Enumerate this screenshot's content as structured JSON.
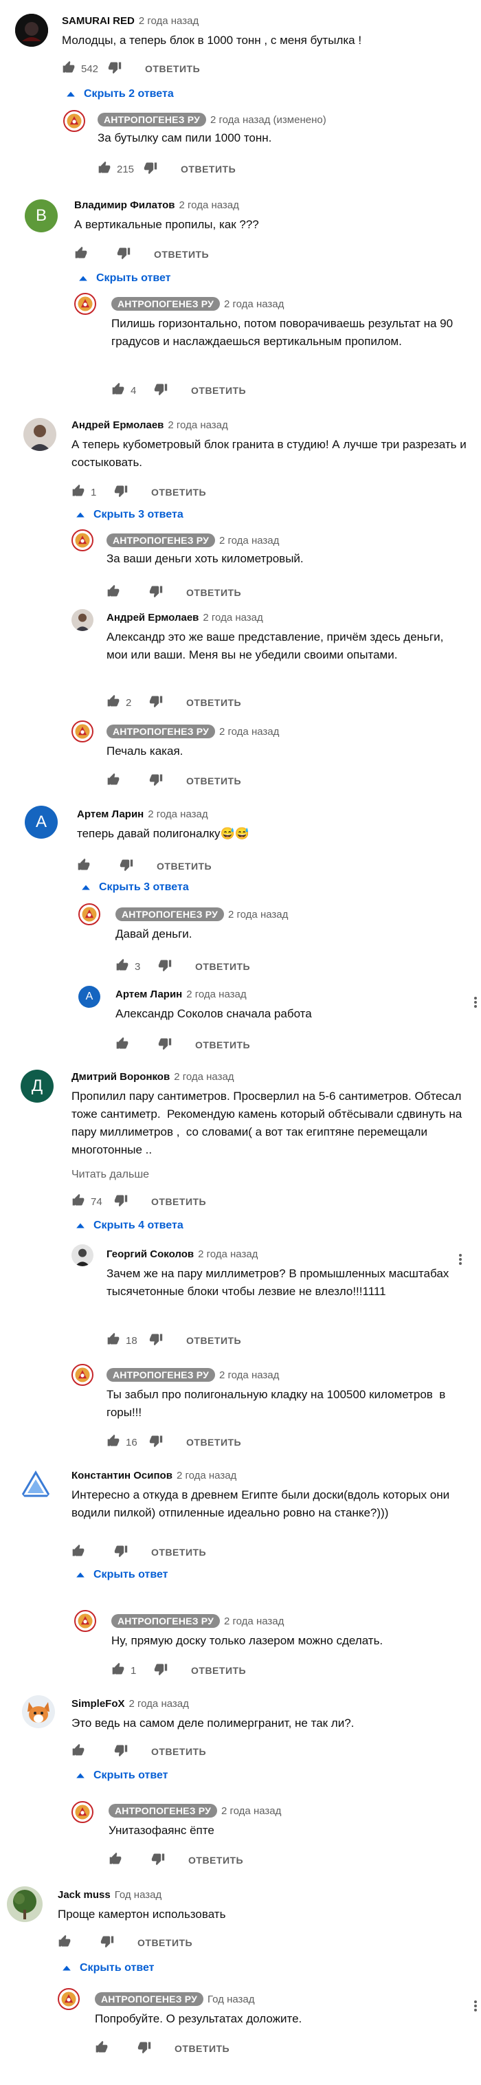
{
  "labels": {
    "reply": "ОТВЕТИТЬ",
    "read_more": "Читать дальше"
  },
  "colors": {
    "link": "#065fd4",
    "badge_bg": "#8b8b8b",
    "text_secondary": "#606060"
  },
  "comments": [
    {
      "author": "SAMURAI RED",
      "time": "2 года назад",
      "text": "Молодцы, а теперь блок в 1000 тонн , с меня бутылка !",
      "likes": "542",
      "toggle": "Скрыть 2 ответа",
      "replies": [
        {
          "author": "АНТРОПОГЕНЕЗ РУ",
          "time": "2 года назад (изменено)",
          "text": "За бутылку сам пили 1000 тонн.",
          "likes": "215"
        }
      ]
    },
    {
      "author": "Владимир Филатов",
      "time": "2 года назад",
      "avatar_letter": "В",
      "text": "А вертикальные пропилы, как ???",
      "likes": "",
      "toggle": "Скрыть ответ",
      "replies": [
        {
          "author": "АНТРОПОГЕНЕЗ РУ",
          "time": "2 года назад",
          "text": "Пилишь горизонтально, потом поворачиваешь результат на 90 градусов и наслаждаешься вертикальным пропилом.",
          "likes": "4"
        }
      ]
    },
    {
      "author": "Андрей Ермолаев",
      "time": "2 года назад",
      "text": "А теперь кубометровый блок гранита в студию! А лучше три разрезать и состыковать.",
      "likes": "1",
      "toggle": "Скрыть 3 ответа",
      "replies": [
        {
          "author": "АНТРОПОГЕНЕЗ РУ",
          "time": "2 года назад",
          "text": "За ваши деньги хоть километровый.",
          "likes": ""
        },
        {
          "author": "Андрей Ермолаев",
          "time": "2 года назад",
          "text": "Александр это же ваше представление, причём здесь деньги, мои или ваши. Меня вы не убедили своими опытами.",
          "likes": "2"
        },
        {
          "author": "АНТРОПОГЕНЕЗ РУ",
          "time": "2 года назад",
          "text": "Печаль какая.",
          "likes": ""
        }
      ]
    },
    {
      "author": "Артем Ларин",
      "time": "2 года назад",
      "avatar_letter": "А",
      "text": "теперь давай полигоналку😅😅",
      "likes": "",
      "toggle": "Скрыть 3 ответа",
      "replies": [
        {
          "author": "АНТРОПОГЕНЕЗ РУ",
          "time": "2 года назад",
          "text": "Давай деньги.",
          "likes": "3"
        },
        {
          "author": "Артем Ларин",
          "time": "2 года назад",
          "text": "Александр Соколов сначала работа",
          "likes": ""
        }
      ]
    },
    {
      "author": "Дмитрий Воронков",
      "time": "2 года назад",
      "avatar_letter": "Д",
      "text": "Пропилил пару сантиметров. Просверлил на 5-6 сантиметров. Обтесал тоже сантиметр.  Рекомендую камень который обтёсывали сдвинуть на пару миллиметров ,  со словами( а вот так египтяне перемещали многотонные ..",
      "likes": "74",
      "toggle": "Скрыть 4 ответа",
      "replies": [
        {
          "author": "Георгий Соколов",
          "time": "2 года назад",
          "text": "Зачем же на пару миллиметров? В промышленных масштабах тысячетонные блоки чтобы лезвие не влезло!!!1111",
          "likes": "18"
        },
        {
          "author": "АНТРОПОГЕНЕЗ РУ",
          "time": "2 года назад",
          "text": "Ты забыл про полигональную кладку на 100500 километров  в горы!!!",
          "likes": "16"
        }
      ]
    },
    {
      "author": "Константин Осипов",
      "time": "2 года назад",
      "text": "Интересно а откуда в древнем Египте были доски(вдоль которых они водили пилкой) отпиленные идеально ровно на станке?)))",
      "likes": "",
      "toggle": "Скрыть ответ",
      "replies": [
        {
          "author": "АНТРОПОГЕНЕЗ РУ",
          "time": "2 года назад",
          "text": "Ну, прямую доску только лазером можно сделать.",
          "likes": "1"
        }
      ]
    },
    {
      "author": "SimpleFoX",
      "time": "2 года назад",
      "text": "Это ведь на самом деле полимергранит, не так ли?.",
      "likes": "",
      "toggle": "Скрыть ответ",
      "replies": [
        {
          "author": "АНТРОПОГЕНЕЗ РУ",
          "time": "2 года назад",
          "text": "Унитазофаянс ёпте",
          "likes": ""
        }
      ]
    },
    {
      "author": "Jack muss",
      "time": "Год назад",
      "text": "Проще камертон использовать",
      "likes": "",
      "toggle": "Скрыть ответ",
      "replies": [
        {
          "author": "АНТРОПОГЕНЕЗ РУ",
          "time": "Год назад",
          "text": "Попробуйте. О результатах доложите.",
          "likes": ""
        }
      ]
    }
  ]
}
